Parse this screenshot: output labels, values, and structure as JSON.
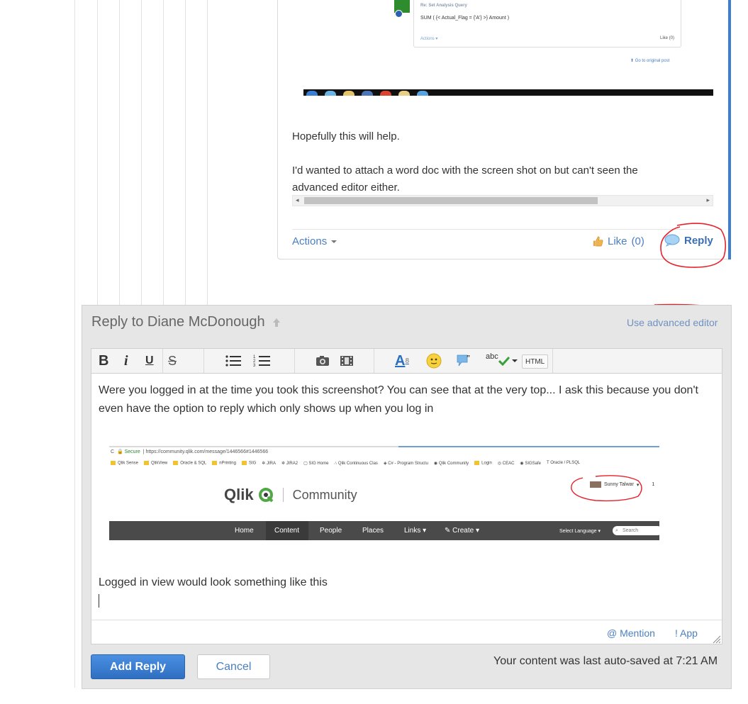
{
  "post": {
    "embedded_post": {
      "title": "Re: Set Analysis Query",
      "expression": "SUM ( {< Actual_Flag = {'A'} >} Amount )",
      "actions": "Actions",
      "like": "Like (0)",
      "go_to_original": "Go to original post"
    },
    "text_1": "Hopefully this will help.",
    "text_2": "I'd wanted to attach a word doc with the screen shot on but can't seen the",
    "text_3": "advanced editor either.",
    "actions_label": "Actions",
    "like_label": "Like",
    "like_count": "(0)",
    "reply_label": "Reply",
    "annotation_color": "#e8202a",
    "accent_color": "#3b7fd1"
  },
  "reply": {
    "heading": "Reply to Diane McDonough",
    "advanced_editor": "Use advanced editor",
    "toolbar": {
      "bold": "B",
      "italic": "i",
      "underline": "U",
      "strike": "S",
      "spell": "abc",
      "html": "HTML",
      "font_color": "A"
    },
    "body_text_1": "Were you logged in at the time you took this screenshot? You can see that at the very top... I ask this because you don't even have the option to reply which only shows up when you log in",
    "body_text_2": "Logged in view would look something like this",
    "screenshot": {
      "secure": "Secure",
      "url": "https://community.qlik.com/message/1446566#1446566",
      "bookmarks": [
        "Qlik Sense",
        "QlikView",
        "Oracle & SQL",
        "nPrinting",
        "SIG",
        "JIRA",
        "JIRA2",
        "SIG Home",
        "Qlik Continuous Clas",
        "C# - Program Structu",
        "Qlik Community",
        "Login",
        "CEAC",
        "SIGSafe",
        "Oracle / PLSQL"
      ],
      "logo_word": "Qlik",
      "logo_community": "Community",
      "user_name": "Sunny Talwar",
      "user_extra": "1",
      "nav": [
        "Home",
        "Content",
        "People",
        "Places",
        "Links",
        "Create"
      ],
      "select_language": "Select Language",
      "search_placeholder": "Search"
    },
    "mention": "@ Mention",
    "app": "! App",
    "add_reply": "Add Reply",
    "cancel": "Cancel",
    "autosave": "Your content was last auto-saved at 7:21 AM"
  }
}
